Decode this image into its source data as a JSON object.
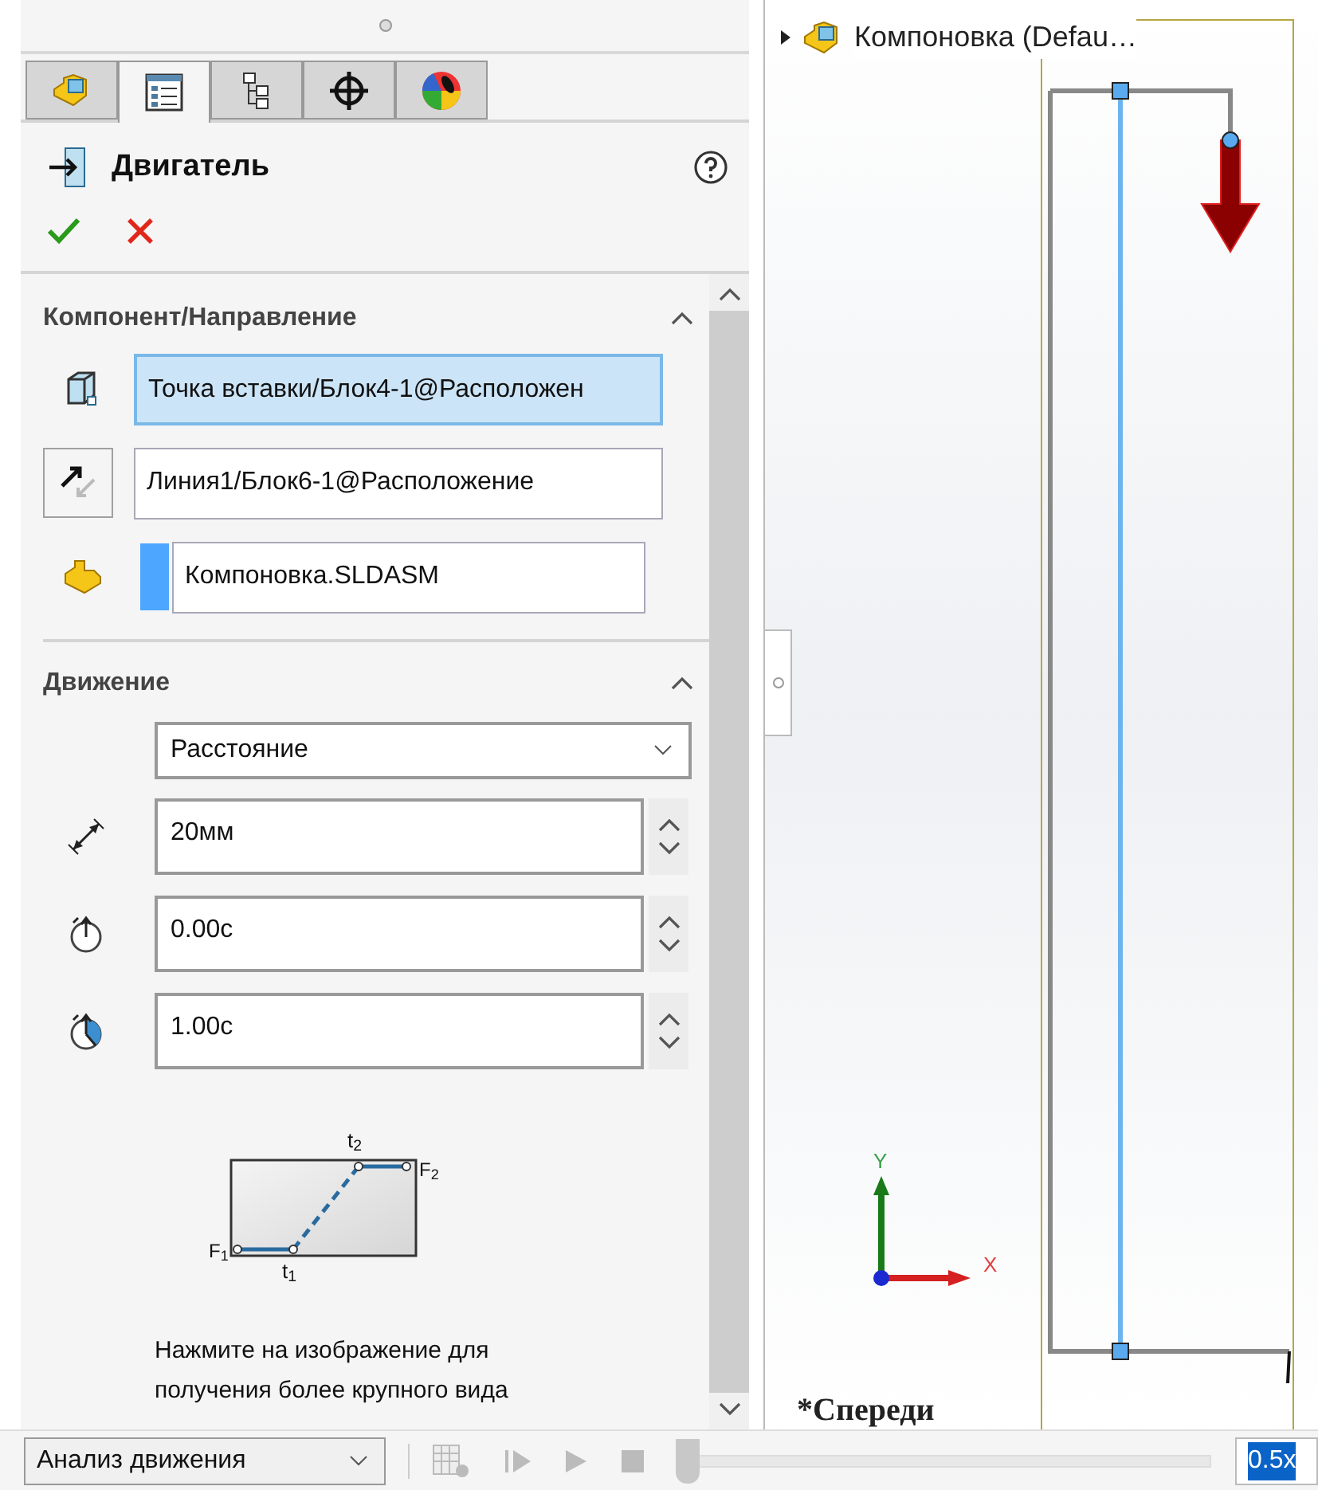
{
  "panel_tabs": [
    {
      "kind": "assembly",
      "selected": false
    },
    {
      "kind": "properties",
      "selected": true
    },
    {
      "kind": "configurations",
      "selected": false
    },
    {
      "kind": "target",
      "selected": false
    },
    {
      "kind": "appearance",
      "selected": false
    }
  ],
  "property_manager": {
    "title": "Двигатель",
    "sections": [
      {
        "title": "Компонент/Направление",
        "expanded": true
      },
      {
        "title": "Движение",
        "expanded": true
      }
    ],
    "component_fields": [
      {
        "kind": "face",
        "value": "Точка вставки/Блок4-1@Расположен",
        "selected": true
      },
      {
        "kind": "direction",
        "value": "Линия1/Блок6-1@Расположение",
        "selected": false
      },
      {
        "kind": "component",
        "value": "Компоновка.SLDASM",
        "selected": false
      }
    ],
    "motion_type": "Расстояние",
    "motion_fields": [
      {
        "kind": "distance",
        "value": "20мм"
      },
      {
        "kind": "start_time",
        "value": "0.00с"
      },
      {
        "kind": "duration",
        "value": "1.00с"
      }
    ],
    "graph_labels": {
      "t_end": "t$_{2}$",
      "f_end": "F$_{2}$",
      "f_start": "F$_{1}$",
      "t_start": "t$_{1}$"
    },
    "hint": "Нажмите на изображение для получения более крупного вида"
  },
  "viewport": {
    "tree_root": "Компоновка (Defau…",
    "axis_y": "Y",
    "axis_x": "X",
    "view_name": "*Спереди"
  },
  "motion_toolbar": {
    "study_type": "Анализ движения",
    "timeline": {
      "level": 0
    },
    "playback_speed": "0.5x"
  }
}
